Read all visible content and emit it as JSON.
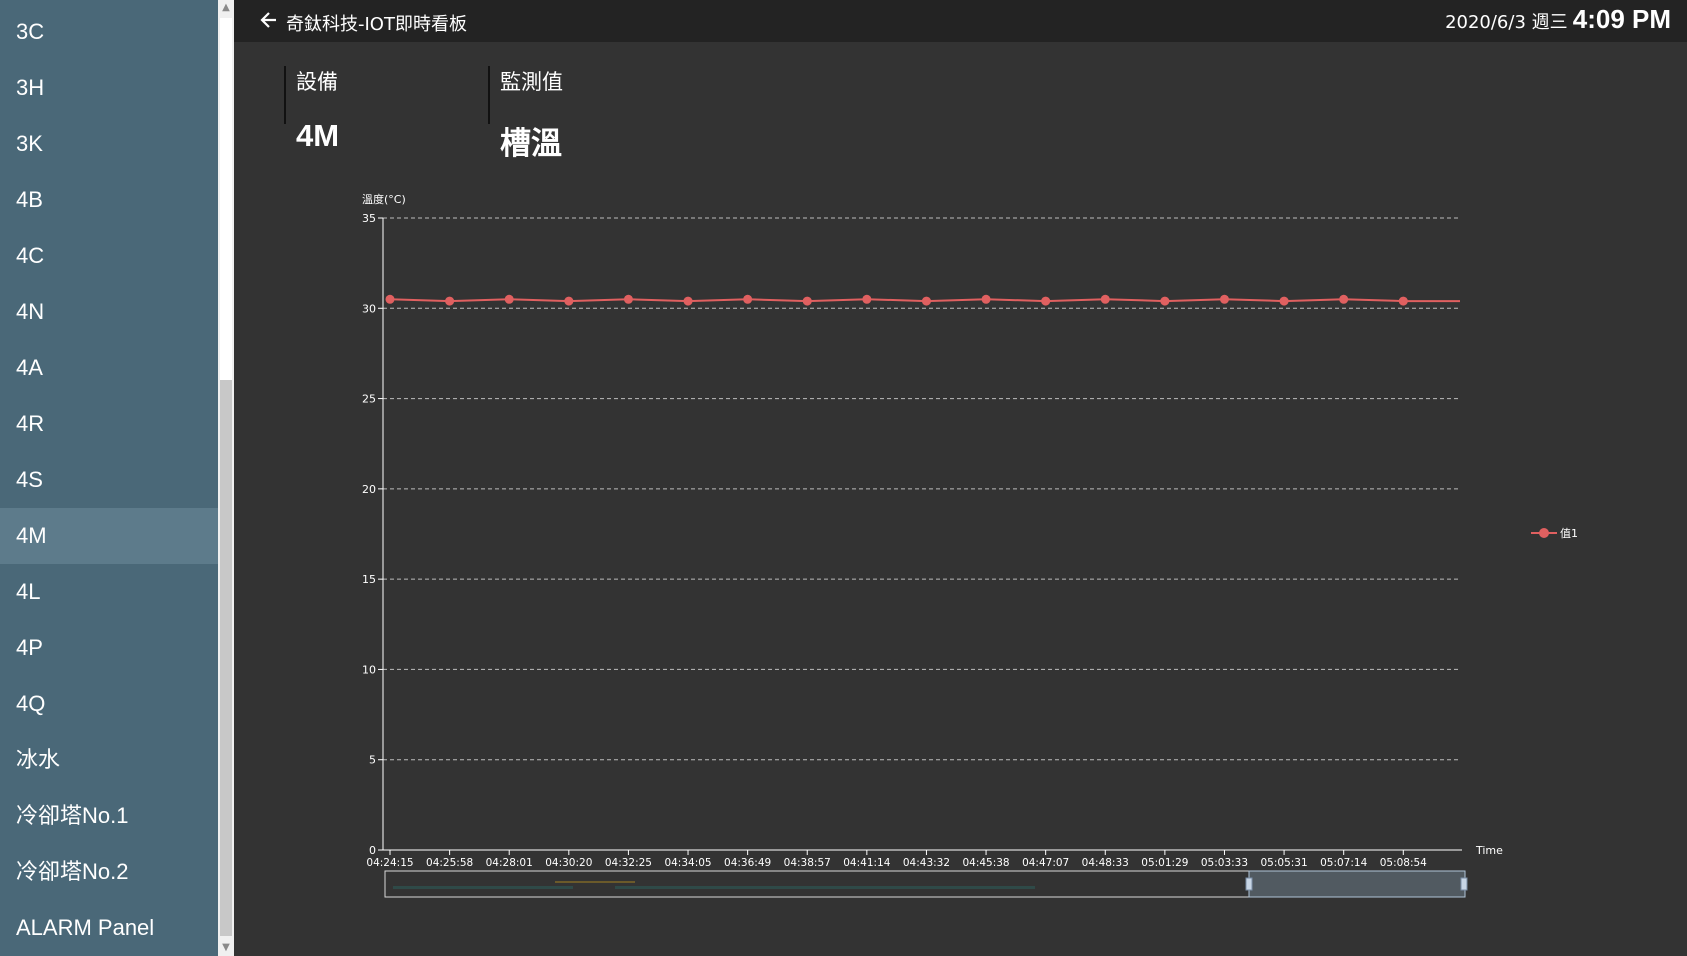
{
  "sidebar": {
    "items": [
      "3C",
      "3H",
      "3K",
      "4B",
      "4C",
      "4N",
      "4A",
      "4R",
      "4S",
      "4M",
      "4L",
      "4P",
      "4Q",
      "冰水",
      "冷卻塔No.1",
      "冷卻塔No.2",
      "ALARM Panel"
    ],
    "selected": "4M"
  },
  "header": {
    "title": "奇鈦科技-IOT即時看板",
    "date": "2020/6/3 週三",
    "time": "4:09 PM"
  },
  "info": {
    "device_label": "設備",
    "device_value": "4M",
    "metric_label": "監測值",
    "metric_value": "槽溫"
  },
  "chart_data": {
    "type": "line",
    "ylabel": "溫度(°C)",
    "xlabel": "Time",
    "ylim": [
      0,
      35
    ],
    "yticks": [
      0,
      5,
      10,
      15,
      20,
      25,
      30,
      35
    ],
    "grid": true,
    "legend_position": "right",
    "x": [
      "04:24:15",
      "04:25:58",
      "04:28:01",
      "04:30:20",
      "04:32:25",
      "04:34:05",
      "04:36:49",
      "04:38:57",
      "04:41:14",
      "04:43:32",
      "04:45:38",
      "04:47:07",
      "04:48:33",
      "05:01:29",
      "05:03:33",
      "05:05:31",
      "05:07:14",
      "05:08:54"
    ],
    "series": [
      {
        "name": "值1",
        "color": "#e06060",
        "values": [
          30.5,
          30.4,
          30.5,
          30.4,
          30.5,
          30.4,
          30.5,
          30.4,
          30.5,
          30.4,
          30.5,
          30.4,
          30.5,
          30.4,
          30.5,
          30.4,
          30.5,
          30.4
        ]
      }
    ],
    "zoom_range": [
      0.8,
      1.0
    ]
  }
}
